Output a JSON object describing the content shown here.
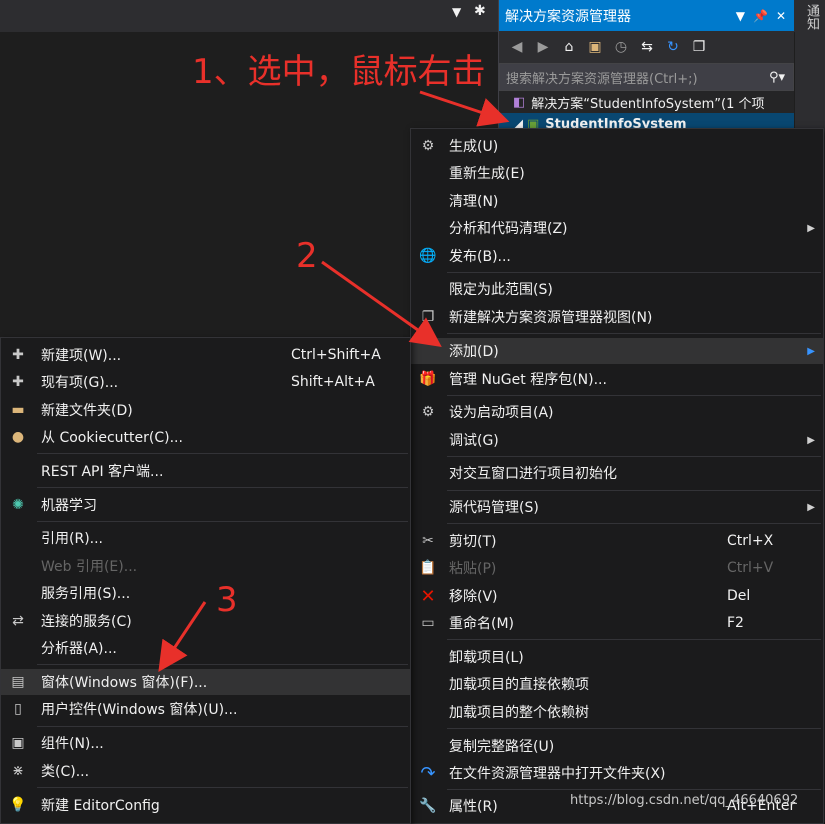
{
  "top": {
    "dropdown_icon": "dropdown-arrow-icon",
    "gear_icon": "gear-icon"
  },
  "notify_label": "通知",
  "solution_explorer": {
    "title": "解决方案资源管理器",
    "search_placeholder": "搜索解决方案资源管理器(Ctrl+;)",
    "solution_row": "解决方案“StudentInfoSystem”(1 个项",
    "project_row": "StudentInfoSystem"
  },
  "right_menu": {
    "items": [
      {
        "icon": "build-icon",
        "label": "生成(U)"
      },
      {
        "label": "重新生成(E)"
      },
      {
        "label": "清理(N)"
      },
      {
        "label": "分析和代码清理(Z)",
        "submenu": "▶"
      },
      {
        "icon": "globe-icon",
        "label": "发布(B)..."
      },
      {
        "label": "限定为此范围(S)"
      },
      {
        "icon": "new-view-icon",
        "label": "新建解决方案资源管理器视图(N)"
      },
      {
        "label": "添加(D)",
        "submenu": "▶"
      },
      {
        "icon": "nuget-icon",
        "label": "管理 NuGet 程序包(N)..."
      },
      {
        "icon": "gear-icon",
        "label": "设为启动项目(A)"
      },
      {
        "label": "调试(G)",
        "submenu": "▶"
      },
      {
        "label": "对交互窗口进行项目初始化"
      },
      {
        "label": "源代码管理(S)",
        "submenu": "▶"
      },
      {
        "icon": "cut-icon",
        "label": "剪切(T)",
        "shortcut": "Ctrl+X"
      },
      {
        "icon": "paste-icon",
        "label": "粘贴(P)",
        "shortcut": "Ctrl+V"
      },
      {
        "icon": "remove-icon",
        "label": "移除(V)",
        "shortcut": "Del"
      },
      {
        "icon": "rename-icon",
        "label": "重命名(M)",
        "shortcut": "F2"
      },
      {
        "label": "卸载项目(L)"
      },
      {
        "label": "加载项目的直接依赖项"
      },
      {
        "label": "加载项目的整个依赖树"
      },
      {
        "label": "复制完整路径(U)"
      },
      {
        "icon": "refresh-icon",
        "label": "在文件资源管理器中打开文件夹(X)"
      },
      {
        "icon": "wrench-icon",
        "label": "属性(R)",
        "shortcut": "Alt+Enter"
      }
    ]
  },
  "left_menu": {
    "items": [
      {
        "icon": "new-item-icon",
        "label": "新建项(W)...",
        "shortcut": "Ctrl+Shift+A"
      },
      {
        "icon": "existing-item-icon",
        "label": "现有项(G)...",
        "shortcut": "Shift+Alt+A"
      },
      {
        "icon": "new-folder-icon",
        "label": "新建文件夹(D)"
      },
      {
        "icon": "cookiecutter-icon",
        "label": "从 Cookiecutter(C)..."
      },
      {
        "label": "REST API 客户端..."
      },
      {
        "icon": "ml-icon",
        "label": "机器学习"
      },
      {
        "label": "引用(R)..."
      },
      {
        "label": "Web 引用(E)..."
      },
      {
        "label": "服务引用(S)..."
      },
      {
        "icon": "connected-service-icon",
        "label": "连接的服务(C)"
      },
      {
        "label": "分析器(A)..."
      },
      {
        "icon": "form-icon",
        "label": "窗体(Windows 窗体)(F)..."
      },
      {
        "icon": "user-control-icon",
        "label": "用户控件(Windows 窗体)(U)..."
      },
      {
        "icon": "component-icon",
        "label": "组件(N)..."
      },
      {
        "icon": "class-icon",
        "label": "类(C)..."
      },
      {
        "icon": "editorconfig-icon",
        "label": "新建 EditorConfig"
      }
    ]
  },
  "annotations": {
    "step1": "1、选中，鼠标右击",
    "step2": "2",
    "step3": "3",
    "color": "#e8302a"
  },
  "watermark": "https://blog.csdn.net/qq_46640692"
}
